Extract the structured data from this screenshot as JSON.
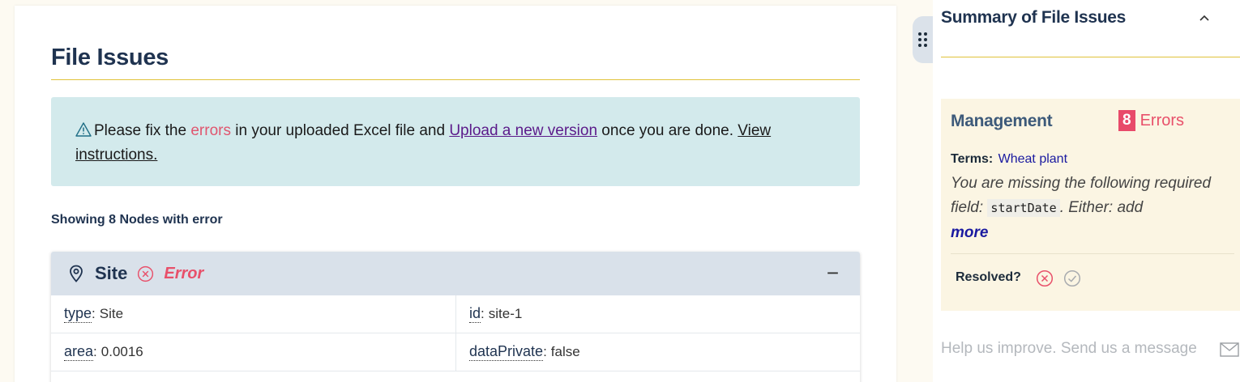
{
  "main": {
    "title": "File Issues",
    "alert": {
      "prefix": "Please fix the ",
      "errors_word": "errors",
      "mid": " in your uploaded  Excel  file and ",
      "upload_link": "Upload a new version",
      "suffix": " once you are done. ",
      "instructions_link": "View instructions."
    },
    "showing_text": "Showing 8 Nodes with error",
    "node": {
      "title": "Site",
      "status": "Error",
      "collapse_symbol": "−",
      "rows": [
        [
          {
            "key": "type",
            "value": "Site"
          },
          {
            "key": "id",
            "value": "site-1"
          }
        ],
        [
          {
            "key": "area",
            "value": "0.0016"
          },
          {
            "key": "dataPrivate",
            "value": "false"
          }
        ]
      ]
    }
  },
  "side": {
    "title": "Summary of File Issues",
    "issue": {
      "category": "Management",
      "error_count": "8",
      "error_label": "Errors",
      "terms_label": "Terms:",
      "terms_value": "Wheat plant",
      "message_before": "You are missing the following required field: ",
      "message_code": "startDate",
      "message_after": ". Either: add",
      "more": "more",
      "resolved_label": "Resolved?"
    },
    "help_text": "Help us improve. Send us a message"
  },
  "colors": {
    "accent_rule": "#e0c23a",
    "error": "#e8506a",
    "alert_bg": "#d3eaec",
    "header_bg": "#d9e1ea",
    "issue_bg": "#fbf5e3"
  },
  "icons": [
    "warning-icon",
    "pin-icon",
    "error-circle-icon",
    "drag-handle-icon",
    "chevron-up-icon",
    "resolve-x-icon",
    "resolve-check-icon",
    "mail-icon"
  ]
}
